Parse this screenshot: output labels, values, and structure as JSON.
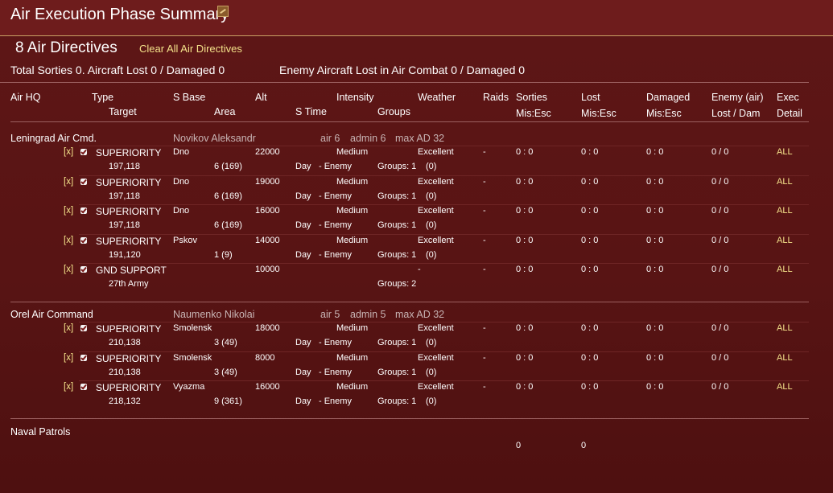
{
  "window": {
    "title": "Air Execution Phase Summary",
    "icon": "pencil-icon"
  },
  "summary": {
    "directives_count": "8 Air Directives",
    "clear_label": "Clear All Air Directives",
    "totals": "Total Sorties 0. Aircraft Lost 0 / Damaged 0",
    "enemy_totals": "Enemy Aircraft Lost in Air Combat 0 / Damaged 0"
  },
  "headers": {
    "row1": {
      "air_hq": "Air HQ",
      "type": "Type",
      "s_base": "S Base",
      "alt": "Alt",
      "intensity": "Intensity",
      "weather": "Weather",
      "raids": "Raids",
      "sorties": "Sorties",
      "lost": "Lost",
      "damaged": "Damaged",
      "enemy": "Enemy (air)",
      "exec": "Exec"
    },
    "row2": {
      "target": "Target",
      "area": "Area",
      "s_time": "S Time",
      "groups": "Groups",
      "sorties_sub": "Mis:Esc",
      "lost_sub": "Mis:Esc",
      "damaged_sub": "Mis:Esc",
      "enemy_sub": "Lost / Dam",
      "exec_sub": "Detail"
    }
  },
  "commands": [
    {
      "name": "Leningrad Air Cmd.",
      "commander": "Novikov Aleksandr",
      "air": "air 6",
      "admin": "admin 6",
      "max_ad": "max AD 32",
      "directives": [
        {
          "x": "[x]",
          "type": "SUPERIORITY",
          "target": "197,118",
          "base": "Dno",
          "area": "6 (169)",
          "alt": "22000",
          "time": "Day",
          "intensity": "Medium",
          "side": "- Enemy",
          "groups": "Groups: 1",
          "weather": "Excellent",
          "weather_sub": "(0)",
          "raids": "-",
          "sorties": "0 : 0",
          "lost": "0 : 0",
          "damaged": "0 : 0",
          "enemy": "0 / 0",
          "exec": "ALL"
        },
        {
          "x": "[x]",
          "type": "SUPERIORITY",
          "target": "197,118",
          "base": "Dno",
          "area": "6 (169)",
          "alt": "19000",
          "time": "Day",
          "intensity": "Medium",
          "side": "- Enemy",
          "groups": "Groups: 1",
          "weather": "Excellent",
          "weather_sub": "(0)",
          "raids": "-",
          "sorties": "0 : 0",
          "lost": "0 : 0",
          "damaged": "0 : 0",
          "enemy": "0 / 0",
          "exec": "ALL"
        },
        {
          "x": "[x]",
          "type": "SUPERIORITY",
          "target": "197,118",
          "base": "Dno",
          "area": "6 (169)",
          "alt": "16000",
          "time": "Day",
          "intensity": "Medium",
          "side": "- Enemy",
          "groups": "Groups: 1",
          "weather": "Excellent",
          "weather_sub": "(0)",
          "raids": "-",
          "sorties": "0 : 0",
          "lost": "0 : 0",
          "damaged": "0 : 0",
          "enemy": "0 / 0",
          "exec": "ALL"
        },
        {
          "x": "[x]",
          "type": "SUPERIORITY",
          "target": "191,120",
          "base": "Pskov",
          "area": "1 (9)",
          "alt": "14000",
          "time": "Day",
          "intensity": "Medium",
          "side": "- Enemy",
          "groups": "Groups: 1",
          "weather": "Excellent",
          "weather_sub": "(0)",
          "raids": "-",
          "sorties": "0 : 0",
          "lost": "0 : 0",
          "damaged": "0 : 0",
          "enemy": "0 / 0",
          "exec": "ALL"
        },
        {
          "x": "[x]",
          "type": "GND SUPPORT",
          "target": "27th Army",
          "base": "",
          "area": "",
          "alt": "10000",
          "time": "",
          "intensity": "",
          "side": "",
          "groups": "Groups: 2",
          "weather": "-",
          "weather_sub": "",
          "raids": "-",
          "sorties": "0 : 0",
          "lost": "0 : 0",
          "damaged": "0 : 0",
          "enemy": "0 / 0",
          "exec": "ALL"
        }
      ]
    },
    {
      "name": "Orel Air Command",
      "commander": "Naumenko Nikolai",
      "air": "air 5",
      "admin": "admin 5",
      "max_ad": "max AD 32",
      "directives": [
        {
          "x": "[x]",
          "type": "SUPERIORITY",
          "target": "210,138",
          "base": "Smolensk",
          "area": "3 (49)",
          "alt": "18000",
          "time": "Day",
          "intensity": "Medium",
          "side": "- Enemy",
          "groups": "Groups: 1",
          "weather": "Excellent",
          "weather_sub": "(0)",
          "raids": "-",
          "sorties": "0 : 0",
          "lost": "0 : 0",
          "damaged": "0 : 0",
          "enemy": "0 / 0",
          "exec": "ALL"
        },
        {
          "x": "[x]",
          "type": "SUPERIORITY",
          "target": "210,138",
          "base": "Smolensk",
          "area": "3 (49)",
          "alt": "8000",
          "time": "Day",
          "intensity": "Medium",
          "side": "- Enemy",
          "groups": "Groups: 1",
          "weather": "Excellent",
          "weather_sub": "(0)",
          "raids": "-",
          "sorties": "0 : 0",
          "lost": "0 : 0",
          "damaged": "0 : 0",
          "enemy": "0 / 0",
          "exec": "ALL"
        },
        {
          "x": "[x]",
          "type": "SUPERIORITY",
          "target": "218,132",
          "base": "Vyazma",
          "area": "9 (361)",
          "alt": "16000",
          "time": "Day",
          "intensity": "Medium",
          "side": "- Enemy",
          "groups": "Groups: 1",
          "weather": "Excellent",
          "weather_sub": "(0)",
          "raids": "-",
          "sorties": "0 : 0",
          "lost": "0 : 0",
          "damaged": "0 : 0",
          "enemy": "0 / 0",
          "exec": "ALL"
        }
      ]
    }
  ],
  "naval": {
    "label": "Naval Patrols",
    "sorties": "0",
    "lost": "0"
  },
  "colors": {
    "background": "#5a1515",
    "title_bar": "#6e1c1c",
    "accent_gold": "#c9a063",
    "link_yellow": "#f4e28a",
    "muted_text": "#c8b4b4"
  }
}
